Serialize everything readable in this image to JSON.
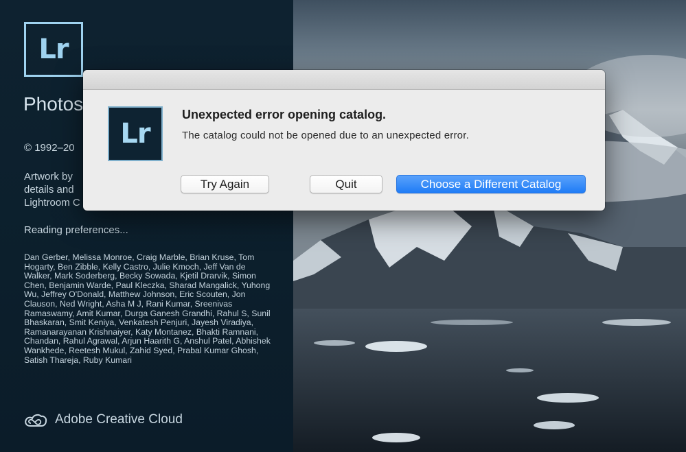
{
  "splash": {
    "logo_text": "Lr",
    "product_name": "Photosh",
    "copyright": "© 1992–20",
    "artwork_lines": [
      "Artwork by",
      "details and",
      "Lightroom C"
    ],
    "status": "Reading preferences...",
    "credits": "Dan Gerber, Melissa Monroe, Craig Marble, Brian Kruse, Tom Hogarty, Ben Zibble, Kelly Castro, Julie Kmoch, Jeff Van de Walker, Mark Soderberg, Becky Sowada, Kjetil Drarvik, Simon Chen, Benjamin Warde, Paul Kleczka, Sharad Mangalick, Yuhong Wu, Jeffrey O'Donald, Matthew Johnson, Eric Scouten, Jon Clauson, Ned Wright, Asha M J, Rani Kumar, Sreenivas Ramaswamy, Amit Kumar, Durga Ganesh Grandhi, Rahul S, Sunil Bhaskaran, Smit Keniya, Venkatesh Penjuri, Jayesh Viradiya, Ramanarayanan Krishnaiyer, Katy Montanez, Bhakti Ramnani, Chandan, Rahul Agrawal, Arjun Haarith G, Anshul Patel, Abhishek Wankhede, Reetesh Mukul, Zahid Syed, Prabal Kumar Ghosh, Satish Thareja, Ruby Kumari",
    "cc_label": "Adobe Creative Cloud"
  },
  "dialog": {
    "icon_text": "Lr",
    "title": "Unexpected error opening catalog.",
    "message": "The catalog could not be opened due to an unexpected error.",
    "buttons": {
      "try_again": "Try Again",
      "quit": "Quit",
      "choose_catalog": "Choose a Different Catalog"
    }
  },
  "colors": {
    "panel_bg": "#0e2230",
    "logo_accent": "#9fd3f0",
    "primary_button": "#1f7cf6",
    "dialog_bg": "#ececec"
  }
}
